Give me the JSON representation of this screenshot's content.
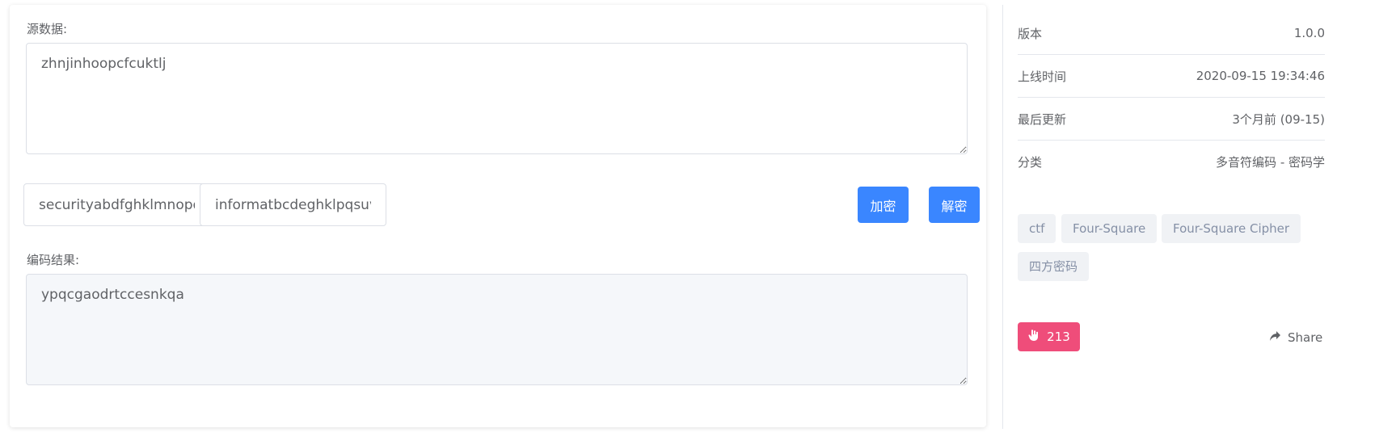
{
  "source": {
    "label": "源数据:",
    "value": "zhnjinhoopcfcuktlj"
  },
  "keys": {
    "key1_value": "securityabdfghklmnopqv",
    "key2_value": "informatbcdeghklpqsuv"
  },
  "actions": {
    "encrypt_label": "加密",
    "decrypt_label": "解密"
  },
  "result": {
    "label": "编码结果:",
    "value": "ypqcgaodrtccesnkqa"
  },
  "info": [
    {
      "key": "版本",
      "value": "1.0.0"
    },
    {
      "key": "上线时间",
      "value": "2020-09-15 19:34:46"
    },
    {
      "key": "最后更新",
      "value": "3个月前 (09-15)"
    },
    {
      "key": "分类",
      "value": "多音符编码 - 密码学"
    }
  ],
  "tags": [
    "ctf",
    "Four-Square",
    "Four-Square Cipher",
    "四方密码"
  ],
  "like": {
    "count": "213",
    "icon": "hand-like-icon"
  },
  "share": {
    "label": "Share",
    "icon": "share-arrow-icon"
  }
}
